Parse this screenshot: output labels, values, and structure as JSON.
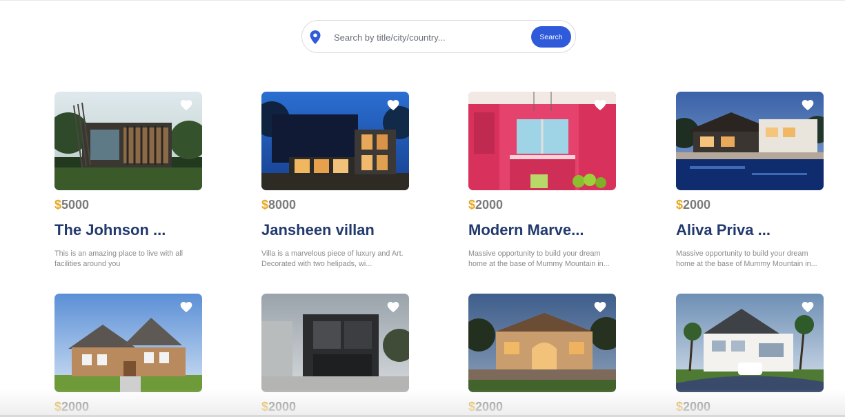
{
  "search": {
    "placeholder": "Search by title/city/country...",
    "button_label": "Search"
  },
  "colors": {
    "accent": "#2f5bdb",
    "price_currency": "#e8a722",
    "title": "#233a6e"
  },
  "listings": [
    {
      "currency": "$",
      "price": "5000",
      "title": "The Johnson ...",
      "description": "This is an amazing place to live with all facilities around you",
      "icon": "heart-icon"
    },
    {
      "currency": "$",
      "price": "8000",
      "title": "Jansheen villan",
      "description": "Villa is a marvelous piece of luxury and Art. Decorated with two helipads, wi...",
      "icon": "heart-icon"
    },
    {
      "currency": "$",
      "price": "2000",
      "title": "Modern Marve...",
      "description": "Massive opportunity to build your dream home at the base of Mummy Mountain in...",
      "icon": "heart-icon"
    },
    {
      "currency": "$",
      "price": "2000",
      "title": "Aliva Priva ...",
      "description": "Massive opportunity to build your dream home at the base of Mummy Mountain in...",
      "icon": "heart-icon"
    },
    {
      "currency": "$",
      "price": "2000",
      "icon": "heart-icon"
    },
    {
      "currency": "$",
      "price": "2000",
      "icon": "heart-icon"
    },
    {
      "currency": "$",
      "price": "2000",
      "icon": "heart-icon"
    },
    {
      "currency": "$",
      "price": "2000",
      "icon": "heart-icon"
    }
  ]
}
